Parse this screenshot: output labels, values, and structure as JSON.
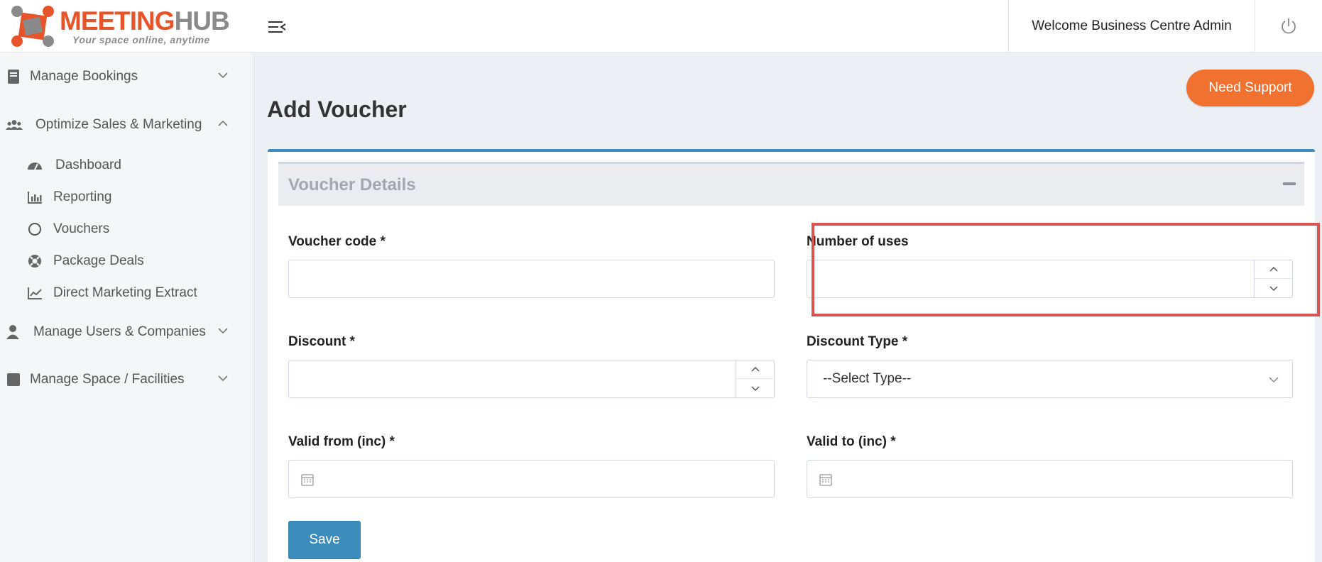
{
  "brand": {
    "name_part1": "MEETING",
    "name_part2": "HUB",
    "tagline": "Your space online, anytime",
    "primary_color": "#e8542a",
    "secondary_color": "#8a8a8a"
  },
  "header": {
    "welcome_text": "Welcome Business Centre Admin",
    "menu_icon": "menu-collapse-icon",
    "power_icon": "power-icon"
  },
  "sidebar": {
    "sections": [
      {
        "label": "Manage Bookings",
        "icon": "book-icon",
        "expanded": false
      },
      {
        "label": "Optimize Sales & Marketing",
        "icon": "users-icon",
        "expanded": true
      },
      {
        "label": "Manage Users & Companies",
        "icon": "user-icon",
        "expanded": false
      },
      {
        "label": "Manage Space / Facilities",
        "icon": "square-icon",
        "expanded": false
      }
    ],
    "sub_items": [
      {
        "label": "Dashboard",
        "icon": "dashboard-icon"
      },
      {
        "label": "Reporting",
        "icon": "bar-chart-icon"
      },
      {
        "label": "Vouchers",
        "icon": "circle-icon"
      },
      {
        "label": "Package Deals",
        "icon": "lifebuoy-icon"
      },
      {
        "label": "Direct Marketing Extract",
        "icon": "line-chart-icon"
      }
    ]
  },
  "main": {
    "title": "Add Voucher",
    "support_button": "Need Support",
    "box_title": "Voucher Details",
    "fields": {
      "voucher_code": {
        "label": "Voucher code *",
        "value": ""
      },
      "number_of_uses": {
        "label": "Number of uses",
        "value": ""
      },
      "discount": {
        "label": "Discount *",
        "value": ""
      },
      "discount_type": {
        "label": "Discount Type *",
        "selected": "--Select Type--"
      },
      "valid_from": {
        "label": "Valid from (inc) *",
        "value": ""
      },
      "valid_to": {
        "label": "Valid to (inc) *",
        "value": ""
      }
    },
    "save_button": "Save"
  },
  "colors": {
    "accent_blue": "#3c8dbc",
    "support_orange": "#f07130",
    "highlight_red": "#d9534f",
    "main_bg": "#ecf0f5"
  }
}
